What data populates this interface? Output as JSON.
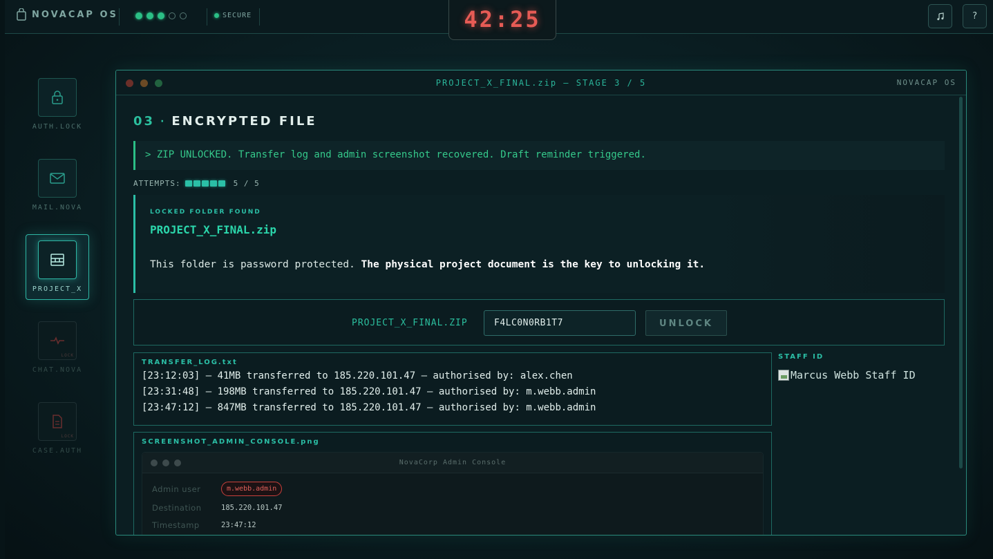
{
  "topbar": {
    "brand": "NOVACAP OS",
    "progress_dots": {
      "completed": 3,
      "total": 5
    },
    "secure_label": "SECURE",
    "timer": "42:25",
    "music_icon": "music-note-icon",
    "help_label": "?"
  },
  "sidebar": {
    "items": [
      {
        "label": "AUTH.LOCK",
        "icon": "lock-icon",
        "state": "unlocked"
      },
      {
        "label": "MAIL.NOVA",
        "icon": "mail-icon",
        "state": "unlocked"
      },
      {
        "label": "PROJECT_X",
        "icon": "archive-icon",
        "state": "active"
      },
      {
        "label": "CHAT.NOVA",
        "icon": "pulse-icon",
        "state": "locked",
        "tag": "LOCK"
      },
      {
        "label": "CASE.AUTH",
        "icon": "document-icon",
        "state": "locked",
        "tag": "LOCK"
      }
    ]
  },
  "window": {
    "title": "PROJECT_X_FINAL.zip — STAGE 3 / 5",
    "os_label": "NOVACAP OS",
    "stage_number": "03",
    "heading": "ENCRYPTED FILE",
    "console_message": "> ZIP UNLOCKED. Transfer log and admin screenshot recovered. Draft reminder triggered.",
    "attempts": {
      "label": "ATTEMPTS:",
      "used": 5,
      "total": 5,
      "text": "5 / 5"
    },
    "found_panel": {
      "label": "LOCKED FOLDER FOUND",
      "file_name": "PROJECT_X_FINAL.zip",
      "description_plain": "This folder is password protected. ",
      "description_bold": "The physical project document is the key to unlocking it."
    },
    "unlock": {
      "zip_label": "PROJECT_X_FINAL.ZIP",
      "password_value": "F4LC0N0RB1T7",
      "button_label": "UNLOCK"
    },
    "transfer_log": {
      "title": "TRANSFER_LOG.txt",
      "lines": [
        "[23:12:03] — 41MB transferred to 185.220.101.47 — authorised by: alex.chen",
        "[23:31:48] — 198MB transferred to 185.220.101.47 — authorised by: m.webb.admin",
        "[23:47:12] — 847MB transferred to 185.220.101.47 — authorised by: m.webb.admin"
      ]
    },
    "staff_id": {
      "title": "STAFF ID",
      "image_alt": "Marcus Webb Staff ID"
    },
    "screenshot": {
      "title": "SCREENSHOT_ADMIN_CONSOLE.png",
      "console_title": "NovaCorp Admin Console",
      "rows": [
        {
          "key": "Admin user",
          "value": "m.webb.admin",
          "highlight": true
        },
        {
          "key": "Destination",
          "value": "185.220.101.47",
          "highlight": false
        },
        {
          "key": "Timestamp",
          "value": "23:47:12",
          "highlight": false
        }
      ]
    }
  },
  "colors": {
    "accent": "#2bbfa6",
    "success": "#2bbf86",
    "timer": "#e65b55",
    "alert": "#c9403c"
  }
}
